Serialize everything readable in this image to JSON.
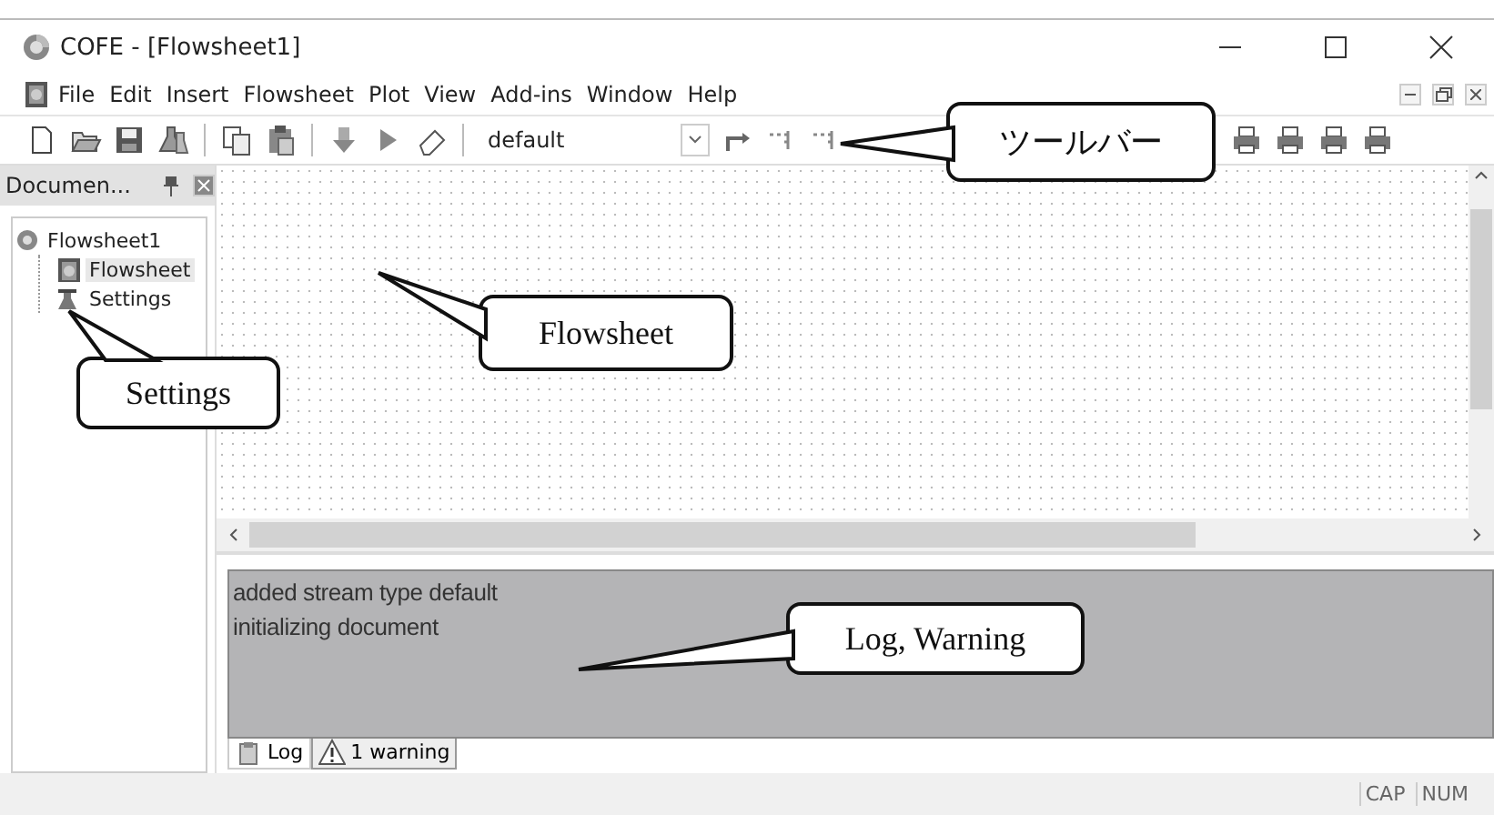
{
  "window": {
    "title": "COFE - [Flowsheet1]"
  },
  "menu": [
    "File",
    "Edit",
    "Insert",
    "Flowsheet",
    "Plot",
    "View",
    "Add-ins",
    "Window",
    "Help"
  ],
  "toolbar": {
    "stream_type": "default"
  },
  "document_panel": {
    "title": "Documen...",
    "tree": [
      {
        "label": "Flowsheet1",
        "children": [
          {
            "label": "Flowsheet",
            "kind": "flowsheet",
            "selected": true
          },
          {
            "label": "Settings",
            "kind": "settings",
            "selected": false
          }
        ]
      }
    ]
  },
  "log": {
    "lines": [
      "added stream type default",
      "initializing document"
    ],
    "tabs": [
      {
        "label": "Log",
        "kind": "log",
        "selected": true
      },
      {
        "label": "1 warning",
        "kind": "warning",
        "selected": false
      }
    ]
  },
  "status_bar": [
    "CAP",
    "NUM"
  ],
  "callouts": [
    {
      "text": "ツールバー"
    },
    {
      "text": "Flowsheet"
    },
    {
      "text": "Settings"
    },
    {
      "text": "Log, Warning"
    }
  ]
}
